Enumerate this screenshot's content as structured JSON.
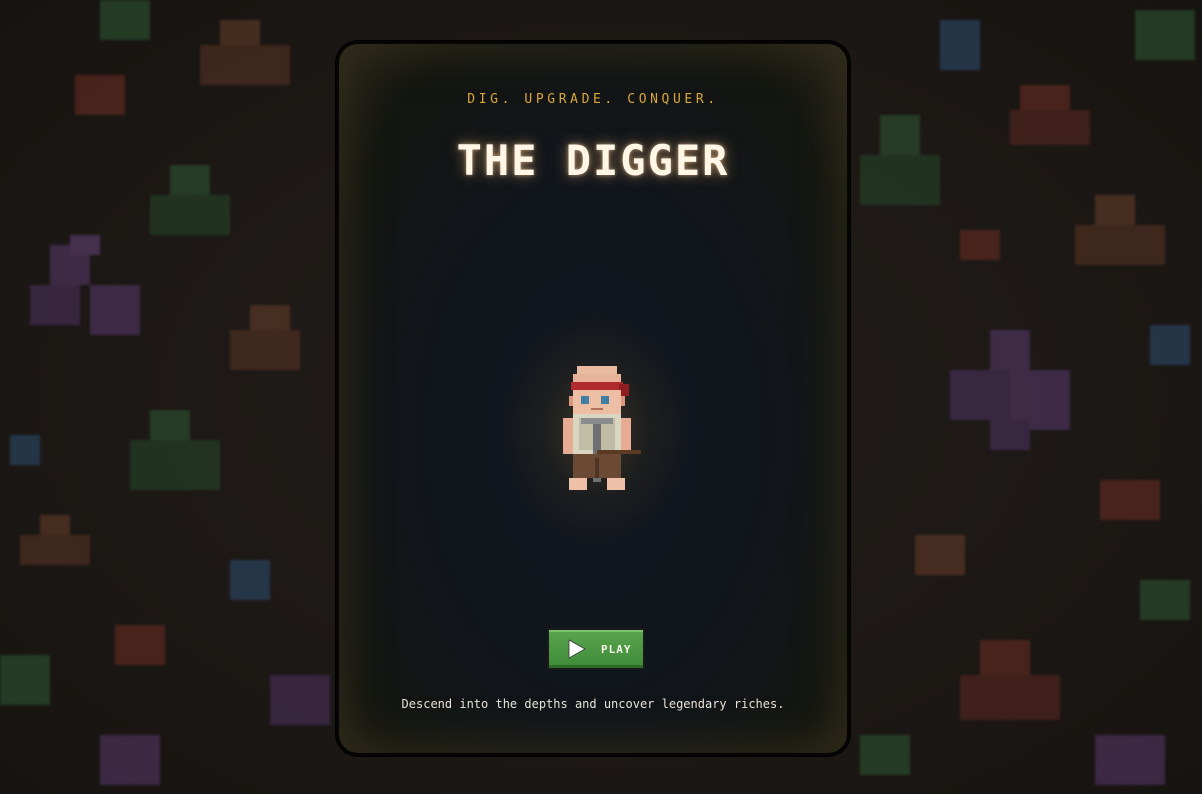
{
  "background": {
    "ore_colors": [
      "#5a3a6e",
      "#6a3f2a",
      "#2f5a34",
      "#2e4f74",
      "#6e2e24"
    ]
  },
  "card": {
    "tagline": "DIG. UPGRADE. CONQUER.",
    "title": "THE DIGGER",
    "character_icon": "miner-character-icon",
    "play_button": {
      "label": "PLAY",
      "icon": "play-icon",
      "color": "#4c9a44"
    },
    "description": "Descend into the depths and uncover legendary riches."
  }
}
